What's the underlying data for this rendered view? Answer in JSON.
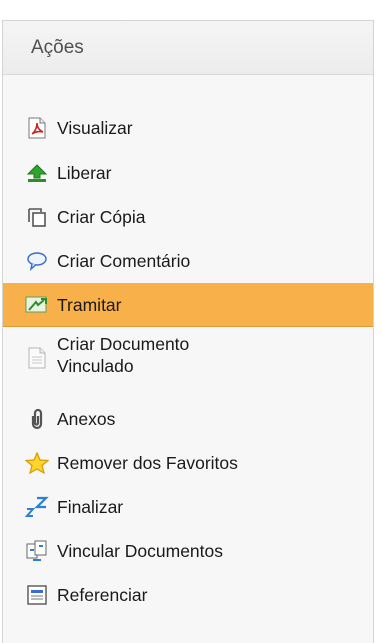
{
  "panel": {
    "title": "Ações",
    "items": [
      {
        "label": "Visualizar",
        "icon": "pdf-icon"
      },
      {
        "label": "Liberar",
        "icon": "upload-icon"
      },
      {
        "label": "Criar Cópia",
        "icon": "copy-icon"
      },
      {
        "label": "Criar Comentário",
        "icon": "comment-icon"
      },
      {
        "label": "Tramitar",
        "icon": "forward-icon",
        "active": true
      },
      {
        "label": "Criar Documento Vinculado",
        "icon": "document-icon"
      },
      {
        "label": "Anexos",
        "icon": "paperclip-icon"
      },
      {
        "label": "Remover dos Favoritos",
        "icon": "star-icon"
      },
      {
        "label": "Finalizar",
        "icon": "sleep-icon"
      },
      {
        "label": "Vincular Documentos",
        "icon": "link-documents-icon"
      },
      {
        "label": "Referenciar",
        "icon": "reference-icon"
      }
    ],
    "active_color": "#f7b04a"
  }
}
